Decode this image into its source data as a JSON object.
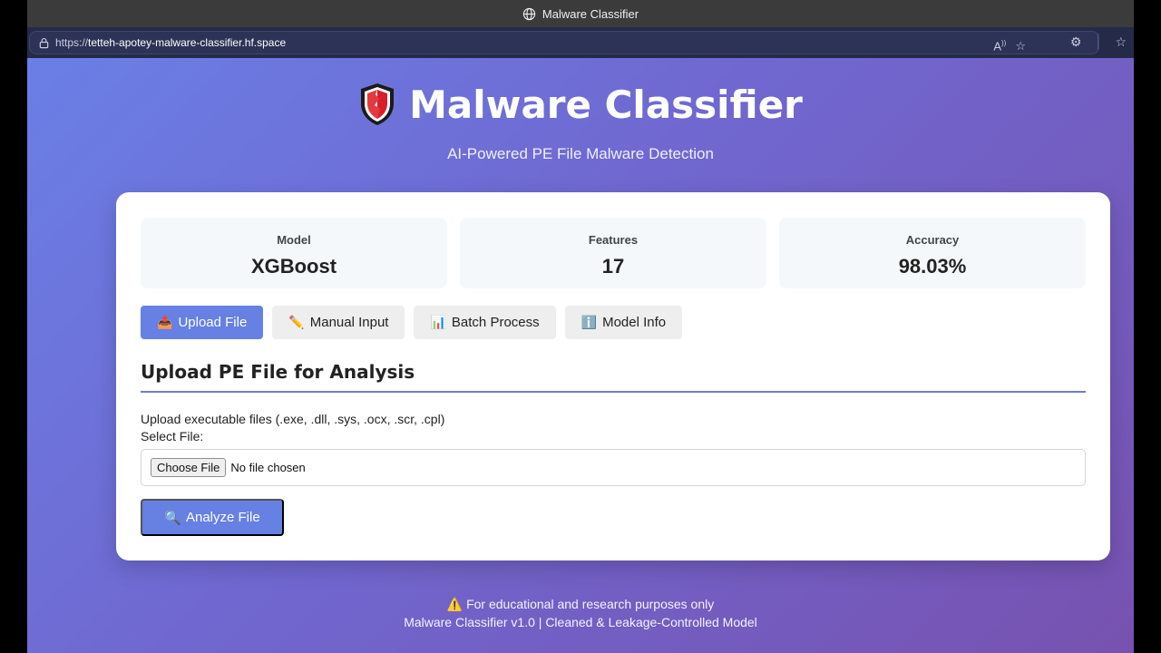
{
  "browser": {
    "window_title": "Malware Classifier",
    "url_prefix": "https://",
    "url_host": "tetteh-apotey-malware-classifier.hf.space"
  },
  "hero": {
    "title": "Malware Classifier",
    "subtitle": "AI-Powered PE File Malware Detection"
  },
  "stats": [
    {
      "label": "Model",
      "value": "XGBoost"
    },
    {
      "label": "Features",
      "value": "17"
    },
    {
      "label": "Accuracy",
      "value": "98.03%"
    }
  ],
  "tabs": [
    {
      "icon": "📤",
      "label": "Upload File"
    },
    {
      "icon": "✏️",
      "label": "Manual Input"
    },
    {
      "icon": "📊",
      "label": "Batch Process"
    },
    {
      "icon": "ℹ️",
      "label": "Model Info"
    }
  ],
  "upload": {
    "section_title": "Upload PE File for Analysis",
    "description": "Upload executable files (.exe, .dll, .sys, .ocx, .scr, .cpl)",
    "file_label": "Select File:",
    "choose_button": "Choose File",
    "no_file_text": "No file chosen",
    "analyze_icon": "🔍",
    "analyze_label": "Analyze File"
  },
  "footer": {
    "warning_icon": "⚠️",
    "notice": "For educational and research purposes only",
    "version": "Malware Classifier v1.0 | Cleaned & Leakage-Controlled Model"
  },
  "colors": {
    "accent": "#6680e4",
    "gradient_start": "#6a7fe6",
    "gradient_end": "#7752b0",
    "shield_red": "#d8202a"
  }
}
